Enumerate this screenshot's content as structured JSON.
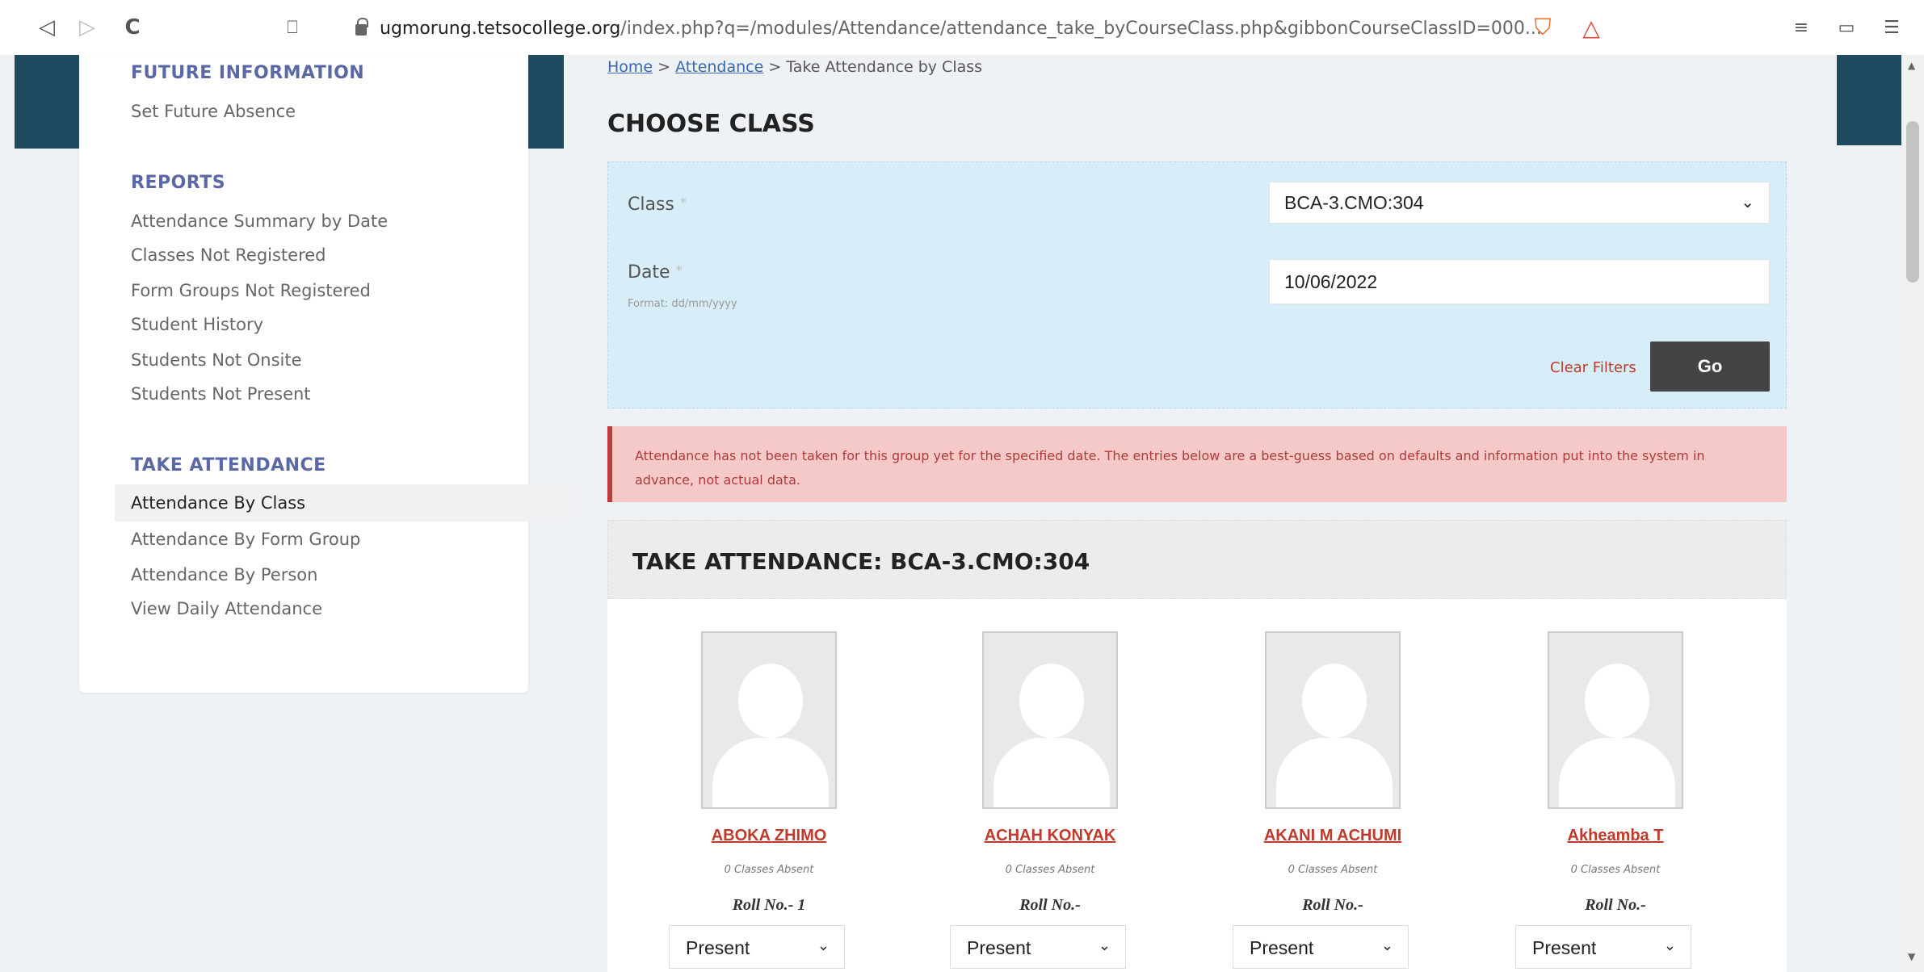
{
  "browser": {
    "url_host": "ugmorung.tetsocollege.org",
    "url_path": "/index.php?q=/modules/Attendance/attendance_take_byCourseClass.php&gibbonCourseClassID=000...",
    "back_icon": "back-arrow-icon",
    "forward_icon": "forward-arrow-icon",
    "reload_icon": "reload-icon",
    "bookmark_icon": "bookmark-icon"
  },
  "sidebar": {
    "sections": [
      {
        "heading": "FUTURE INFORMATION",
        "items": [
          "Set Future Absence"
        ]
      },
      {
        "heading": "REPORTS",
        "items": [
          "Attendance Summary by Date",
          "Classes Not Registered",
          "Form Groups Not Registered",
          "Student History",
          "Students Not Onsite",
          "Students Not Present"
        ]
      },
      {
        "heading": "TAKE ATTENDANCE",
        "items": [
          "Attendance By Class",
          "Attendance By Form Group",
          "Attendance By Person",
          "View Daily Attendance"
        ]
      }
    ],
    "active_item": "Attendance By Class"
  },
  "breadcrumb": {
    "home": "Home",
    "sep": ">",
    "attendance": "Attendance",
    "current": "Take Attendance by Class"
  },
  "page_title": "CHOOSE CLASS",
  "filter": {
    "class_label": "Class",
    "class_value": "BCA-3.CMO:304",
    "date_label": "Date",
    "required_mark": "*",
    "date_hint": "Format: dd/mm/yyyy",
    "date_value": "10/06/2022",
    "clear_label": "Clear Filters",
    "go_label": "Go"
  },
  "alert": "Attendance has not been taken for this group yet for the specified date. The entries below are a best-guess based on defaults and information put into the system in advance, not actual data.",
  "attendance": {
    "title": "TAKE ATTENDANCE: BCA-3.CMO:304",
    "students": [
      {
        "name": "ABOKA ZHIMO",
        "absent": "0 Classes Absent",
        "roll": "Roll No.- 1",
        "status": "Present"
      },
      {
        "name": "ACHAH KONYAK",
        "absent": "0 Classes Absent",
        "roll": "Roll No.-",
        "status": "Present"
      },
      {
        "name": "AKANI M ACHUMI",
        "absent": "0 Classes Absent",
        "roll": "Roll No.-",
        "status": "Present"
      },
      {
        "name": "Akheamba T",
        "absent": "0 Classes Absent",
        "roll": "Roll No.-",
        "status": "Present"
      }
    ]
  },
  "colors": {
    "accent_dark": "#1f4a5f",
    "link": "#3b67b0",
    "heading": "#5a68a5",
    "error": "#c0392b",
    "filter_bg": "#d7eef8",
    "alert_bg": "#f6c9c9"
  }
}
